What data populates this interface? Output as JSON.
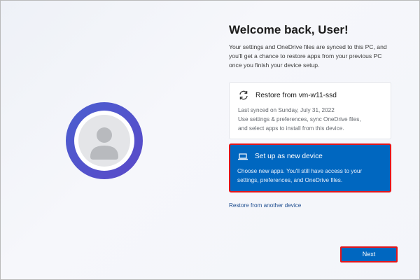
{
  "page": {
    "title": "Welcome back, User!",
    "description_lines": [
      "Your settings and OneDrive files are synced to this PC, and",
      "you'll get a chance to restore apps from your previous PC",
      "once you finish your device setup."
    ]
  },
  "avatar": {
    "icon": "user-avatar-icon"
  },
  "options": {
    "restore": {
      "icon": "sync-icon",
      "title": "Restore from vm-w11-ssd",
      "body_lines": [
        "Last synced on Sunday, July 31, 2022",
        "Use settings & preferences, sync OneDrive files,",
        "and select apps to install from this device."
      ]
    },
    "new_device": {
      "icon": "laptop-icon",
      "title": "Set up as new device",
      "body_lines": [
        "Choose new apps. You'll still have access to your",
        "settings, preferences, and OneDrive files."
      ],
      "selected": true
    }
  },
  "links": {
    "restore_other": "Restore from another device"
  },
  "buttons": {
    "next": "Next"
  },
  "colors": {
    "accent": "#0067c0",
    "highlight_border": "#e0151b",
    "avatar_ring": "#4b5fd0"
  }
}
